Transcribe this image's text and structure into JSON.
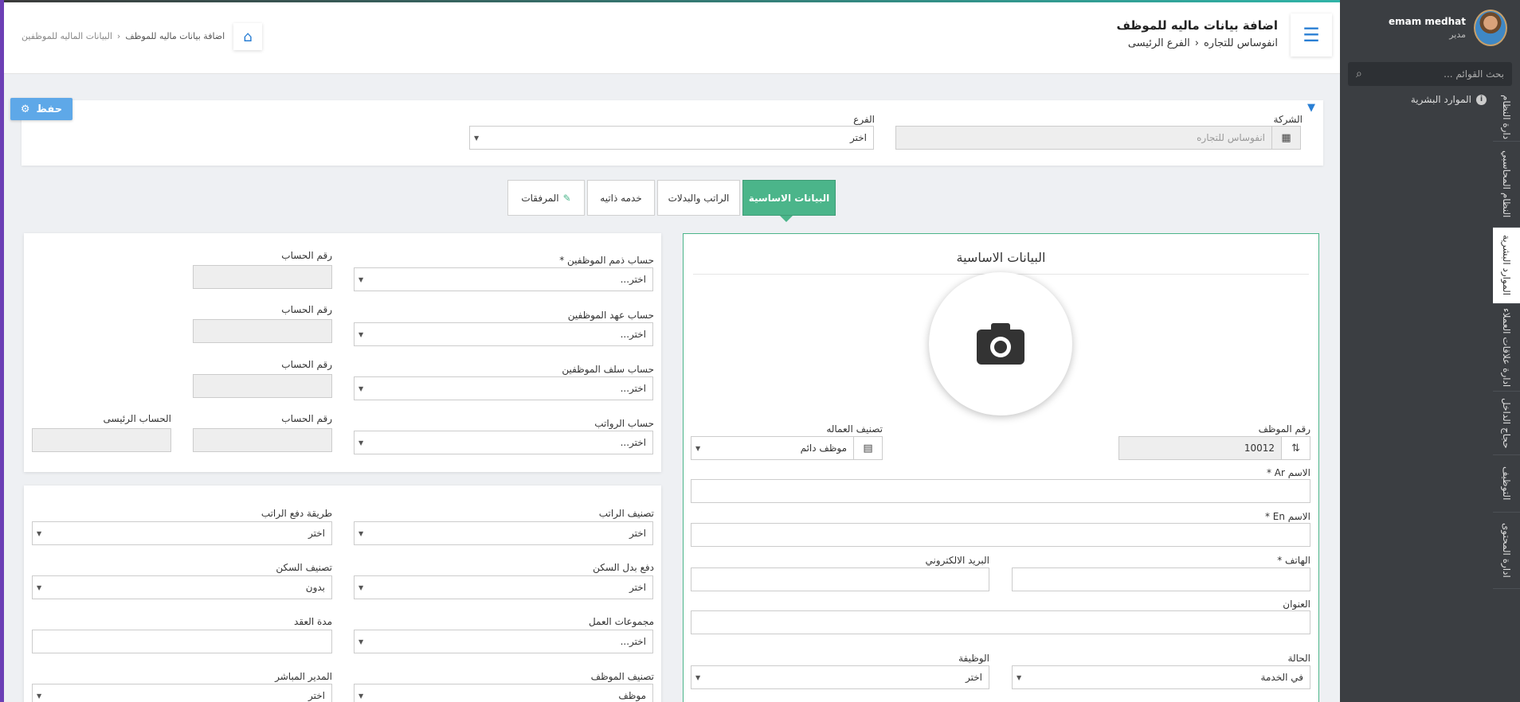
{
  "sidebar": {
    "user_name": "emam medhat",
    "user_role": "مدير",
    "search_placeholder": "بحث القوائم ...",
    "active_item": "الموارد البشرية",
    "tabs": [
      "دارة النظام",
      "النظام المحاسبي",
      "الموارد البشرية",
      "ادارة علاقات العملاء",
      "حجاج الداخل",
      "التوظيف",
      "ادارة المحتوى"
    ]
  },
  "header": {
    "title": "اضافة بيانات ماليه للموظف",
    "company": "انفوساس للتجاره",
    "branch": "الفرع الرئيسى",
    "breadcrumb": [
      "البيانات الماليه للموظفين",
      "اضافة بيانات ماليه للموظف"
    ]
  },
  "filter": {
    "save_label": "حفظ",
    "company_label": "الشركة",
    "company_value": "انفوساس للتجاره",
    "branch_label": "الفرع",
    "branch_value": "اختر"
  },
  "tabs": [
    {
      "label": "البيانات الاساسية",
      "active": true
    },
    {
      "label": "الراتب والبدلات",
      "active": false
    },
    {
      "label": "خدمه ذاتيه",
      "active": false
    },
    {
      "label": "المرفقات",
      "active": false
    }
  ],
  "basic": {
    "title": "البيانات الاساسية",
    "emp_no_label": "رقم الموظف",
    "emp_no_value": "10012",
    "labor_class_label": "تصنيف العماله",
    "labor_class_value": "موظف دائم",
    "name_ar_label": "الاسم Ar *",
    "name_en_label": "الاسم En *",
    "phone_label": "الهاتف *",
    "email_label": "البريد الالكتروني",
    "address_label": "العنوان",
    "status_label": "الحالة",
    "status_value": "في الخدمة",
    "job_label": "الوظيفة",
    "job_value": "اختر"
  },
  "accounts": {
    "rows": [
      {
        "label": "حساب ذمم الموظفين *",
        "value": "اختر...",
        "acc_label": "رقم الحساب"
      },
      {
        "label": "حساب عهد الموظفين",
        "value": "اختر...",
        "acc_label": "رقم الحساب"
      },
      {
        "label": "حساب سلف الموظفين",
        "value": "اختر...",
        "acc_label": "رقم الحساب"
      },
      {
        "label": "حساب الرواتب",
        "value": "اختر...",
        "acc_label": "رقم الحساب"
      }
    ],
    "main_account_label": "الحساب الرئيسى"
  },
  "salary": {
    "salary_class_label": "تصنيف الراتب",
    "salary_class_value": "اختر",
    "pay_method_label": "طريقة دفع الراتب",
    "pay_method_value": "اختر",
    "housing_pay_label": "دفع بدل السكن",
    "housing_pay_value": "اختر",
    "housing_class_label": "تصنيف السكن",
    "housing_class_value": "بدون",
    "work_groups_label": "مجموعات العمل",
    "work_groups_value": "اختر...",
    "contract_label": "مدة العقد",
    "emp_class_label": "تصنيف الموظف",
    "emp_class_value": "موظف",
    "manager_label": "المدير المباشر",
    "manager_value": "اختر"
  },
  "colors": {
    "accent": "#2a7fd4",
    "green": "#4bb58a",
    "sidebar": "#3b3e42"
  }
}
